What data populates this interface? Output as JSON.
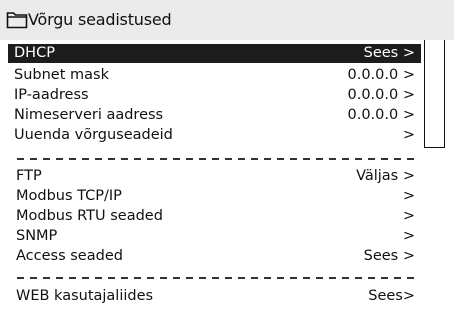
{
  "header": {
    "title": "Võrgu seadistused",
    "icon": "folder-icon"
  },
  "network_list": [
    {
      "label": "DHCP",
      "value": "Sees >",
      "selected": true
    },
    {
      "label": "Subnet mask",
      "value": "0.0.0.0  >"
    },
    {
      "label": "IP-aadress",
      "value": "0.0.0.0 >"
    },
    {
      "label": "Nimeserveri aadress",
      "value": "0.0.0.0  >"
    },
    {
      "label": "Uuenda võrguseadeid",
      "value": ">"
    }
  ],
  "services_list": [
    {
      "label": "FTP",
      "value": "Väljas >"
    },
    {
      "label": "Modbus TCP/IP",
      "value": ">"
    },
    {
      "label": "Modbus RTU seaded",
      "value": ">"
    },
    {
      "label": "SNMP",
      "value": ">"
    },
    {
      "label": "Access  seaded",
      "value": "Sees  >"
    }
  ],
  "web_list": [
    {
      "label": "WEB kasutajaliides",
      "value": "Sees>"
    }
  ],
  "colors": {
    "header_bg": "#ebebeb",
    "selected_bg": "#1c1c1c",
    "text": "#111111"
  }
}
